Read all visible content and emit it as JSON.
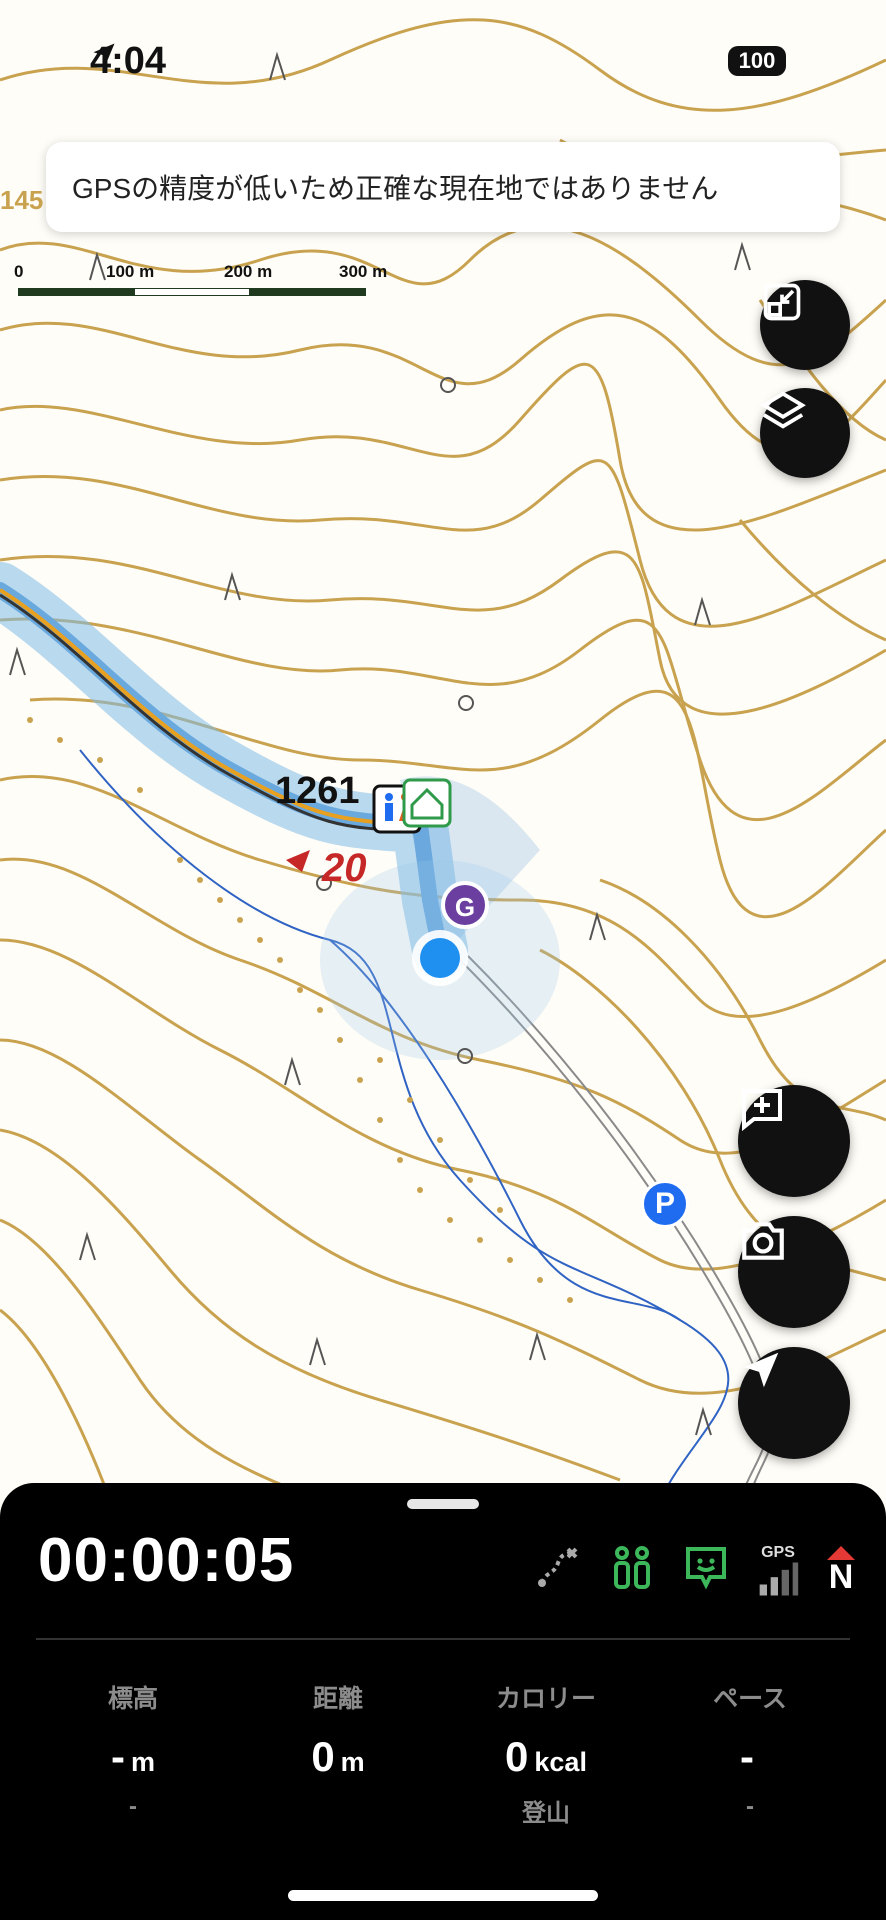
{
  "status": {
    "time": "4:04",
    "battery": "100"
  },
  "map": {
    "banner": "GPSの精度が低いため正確な現在地ではありません",
    "scale_labels": [
      "0",
      "100 m",
      "200 m",
      "300 m"
    ],
    "edge_label": "145",
    "elevation_label": "1261",
    "marker_number": "20",
    "parking_label": "P",
    "goal_label": "G"
  },
  "panel": {
    "timer": "00:00:05",
    "gps_label": "GPS",
    "compass_label": "N",
    "stats": [
      {
        "label": "標高",
        "value": "-",
        "unit": "m",
        "sub": "-"
      },
      {
        "label": "距離",
        "value": "0",
        "unit": "m",
        "sub": ""
      },
      {
        "label": "カロリー",
        "value": "0",
        "unit": "kcal",
        "sub": "登山"
      },
      {
        "label": "ペース",
        "value": "-",
        "unit": "",
        "sub": "-"
      }
    ]
  },
  "colors": {
    "contour": "#c8a24f",
    "route": "#6aa9de",
    "accent": "#1f6cf0",
    "panel_bg": "#000000"
  },
  "icons": [
    "location-arrow-icon",
    "scale-resize-icon",
    "layers-icon",
    "add-memo-icon",
    "camera-icon",
    "navigate-icon",
    "route-edit-icon",
    "people-icon",
    "face-icon",
    "gps-signal-icon",
    "compass-icon"
  ]
}
